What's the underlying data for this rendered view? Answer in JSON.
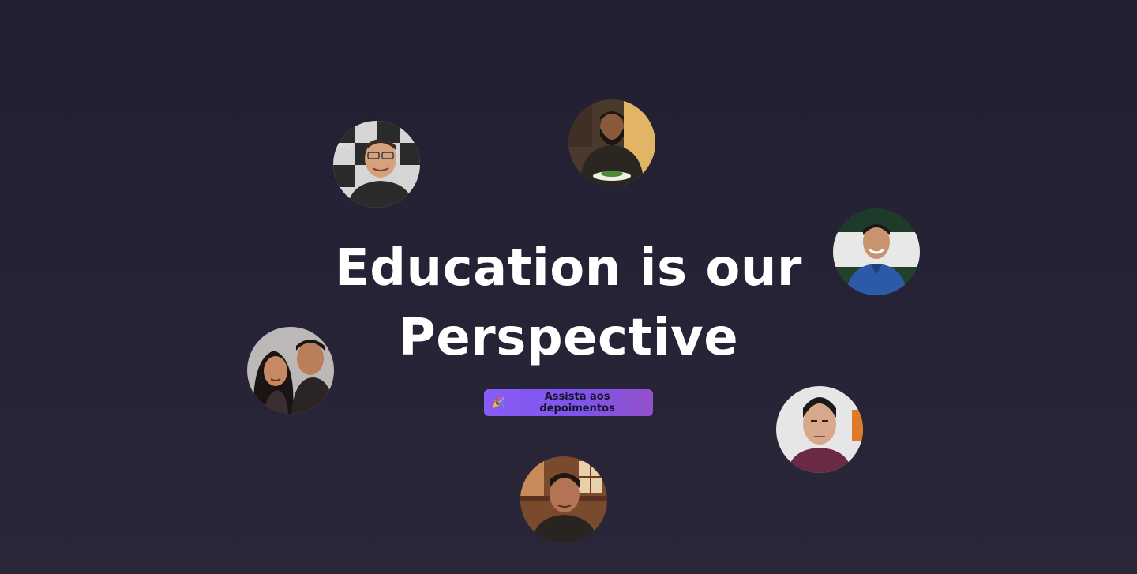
{
  "hero": {
    "title_line1": "Education is our",
    "title_line2": "Perspective"
  },
  "cta": {
    "icon": "party-popper-icon",
    "label": "Assista aos depoimentos"
  },
  "avatars": [
    {
      "name": "avatar-man-glasses",
      "bg": "#cfcfcf",
      "skin": "#d4a27c",
      "hair": "#3a2c24",
      "shirt": "#2b2b2b"
    },
    {
      "name": "avatar-man-beard",
      "bg": "#d8b070",
      "skin": "#8a5a3a",
      "hair": "#1c1410",
      "shirt": "#2a2622"
    },
    {
      "name": "avatar-man-smiling",
      "bg": "#264a34",
      "skin": "#c8946e",
      "hair": "#1a1412",
      "shirt": "#2c5aa8"
    },
    {
      "name": "avatar-couple",
      "bg": "#b9b4b4",
      "skin": "#c58a64",
      "hair": "#1a1414",
      "shirt": "#2a2424"
    },
    {
      "name": "avatar-man-serious",
      "bg": "#e6e6e6",
      "skin": "#d8a88a",
      "hair": "#1c1818",
      "shirt": "#6a2a44"
    },
    {
      "name": "avatar-man-restaurant",
      "bg": "#8a5434",
      "skin": "#b27452",
      "hair": "#1e1612",
      "shirt": "#2a2420"
    }
  ],
  "accent": "#8a5cf6"
}
